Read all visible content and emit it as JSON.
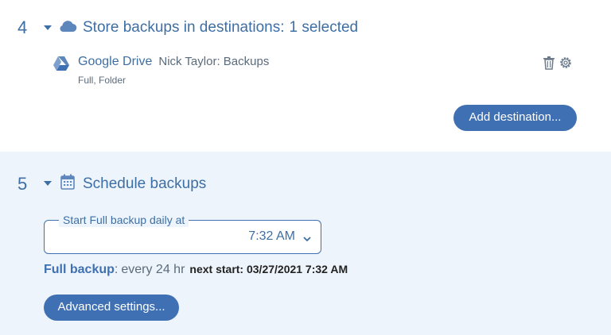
{
  "destinations_section": {
    "number": "4",
    "title": "Store backups in destinations:",
    "selected": "1 selected",
    "destination": {
      "provider": "Google Drive",
      "account": "Nick Taylor: Backups",
      "details": "Full, Folder"
    },
    "add_button": "Add destination..."
  },
  "schedule_section": {
    "number": "5",
    "title": "Schedule backups",
    "field_legend": "Start Full backup daily at",
    "time_value": "7:32 AM",
    "summary_label": "Full backup",
    "summary_colon": ":",
    "summary_interval": "every 24 hr",
    "summary_next": "next start: 03/27/2021 7:32 AM",
    "advanced_button": "Advanced settings..."
  },
  "colors": {
    "accent": "#3f70b3",
    "section_bg": "#eef4fb"
  },
  "icons": [
    "cloud-icon",
    "google-drive-icon",
    "trash-icon",
    "gear-icon",
    "calendar-icon",
    "chevron-down-icon"
  ]
}
